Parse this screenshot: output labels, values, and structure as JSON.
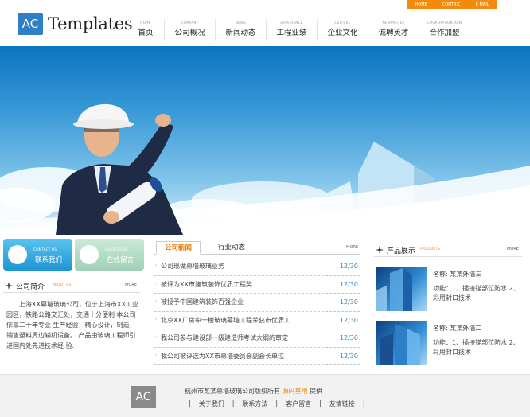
{
  "header": {
    "logo_badge": "AC",
    "logo_text": "Templates",
    "topbar": [
      "HOME",
      "CONTRIC",
      "E-MAIL"
    ],
    "nav": [
      {
        "en": "HOME",
        "cn": "首页"
      },
      {
        "en": "COMPANY",
        "cn": "公司概况"
      },
      {
        "en": "NEWS",
        "cn": "新闻动态"
      },
      {
        "en": "EXPERIENCE",
        "cn": "工程业绩"
      },
      {
        "en": "CULTURE",
        "cn": "企业文化"
      },
      {
        "en": "NEWPAGTES",
        "cn": "诚聘英才"
      },
      {
        "en": "COOPERATION JOIN",
        "cn": "合作加盟"
      }
    ]
  },
  "contact": {
    "en": "CONTACT US",
    "cn": "联系我们"
  },
  "message": {
    "en": "QUESTBOOK",
    "cn": "在线留言"
  },
  "intro": {
    "title": "公司简介",
    "en": "ABOUT US",
    "more": "MORE",
    "text": "上海XX幕墙玻璃公司，位于上海市XX工业园区，铁路公路交汇处，交通十分便利 本公司依靠二十年专业 生产经验，精心设计，制造，销售塑料周边辅机设备。 产品由玻璃工程师引进国内处先进技术经 验."
  },
  "news": {
    "tab_active": "公司新闻",
    "tab_inactive": "行业动态",
    "more": "MORE",
    "items": [
      {
        "text": "公司现做幕墙玻璃业务",
        "date": "12/30"
      },
      {
        "text": "被评为XX市建筑装饰优质工程奖",
        "date": "12/30"
      },
      {
        "text": "被授予中国建筑装饰百强企业",
        "date": "12/30"
      },
      {
        "text": "北京XX厂房中一楼玻璃幕墙工程荣获市优质工",
        "date": "12/30"
      },
      {
        "text": "我公司参与建设部一级建造师考试大纲的审定",
        "date": "12/30"
      },
      {
        "text": "我公司被评选为XX市幕墙委员会副会长单位",
        "date": "12/30"
      }
    ]
  },
  "products": {
    "title": "产品展示",
    "en": "PRODUCTS",
    "more": "MORE",
    "items": [
      {
        "name": "名称: 某某外墙三",
        "desc": "功能：1、插接锚部位防水 2、彩用封口技术"
      },
      {
        "name": "名称: 某某外墙二",
        "desc": "功能：1、插接锚部位防水 2、彩用封口技术"
      }
    ]
  },
  "footer": {
    "badge": "AC",
    "line_prefix": "杭州市某某幕墙玻璃公司版权所有",
    "line_highlight": "源码基地",
    "line_suffix": "提供",
    "links": [
      "|",
      "关于我们",
      "|",
      "联系方法",
      "|",
      "客户留言",
      "|",
      "友情链接",
      "|"
    ]
  },
  "colors": {
    "brand_blue": "#2f7fc8",
    "accent_orange": "#f28a0c",
    "date_blue": "#1b83c8"
  }
}
